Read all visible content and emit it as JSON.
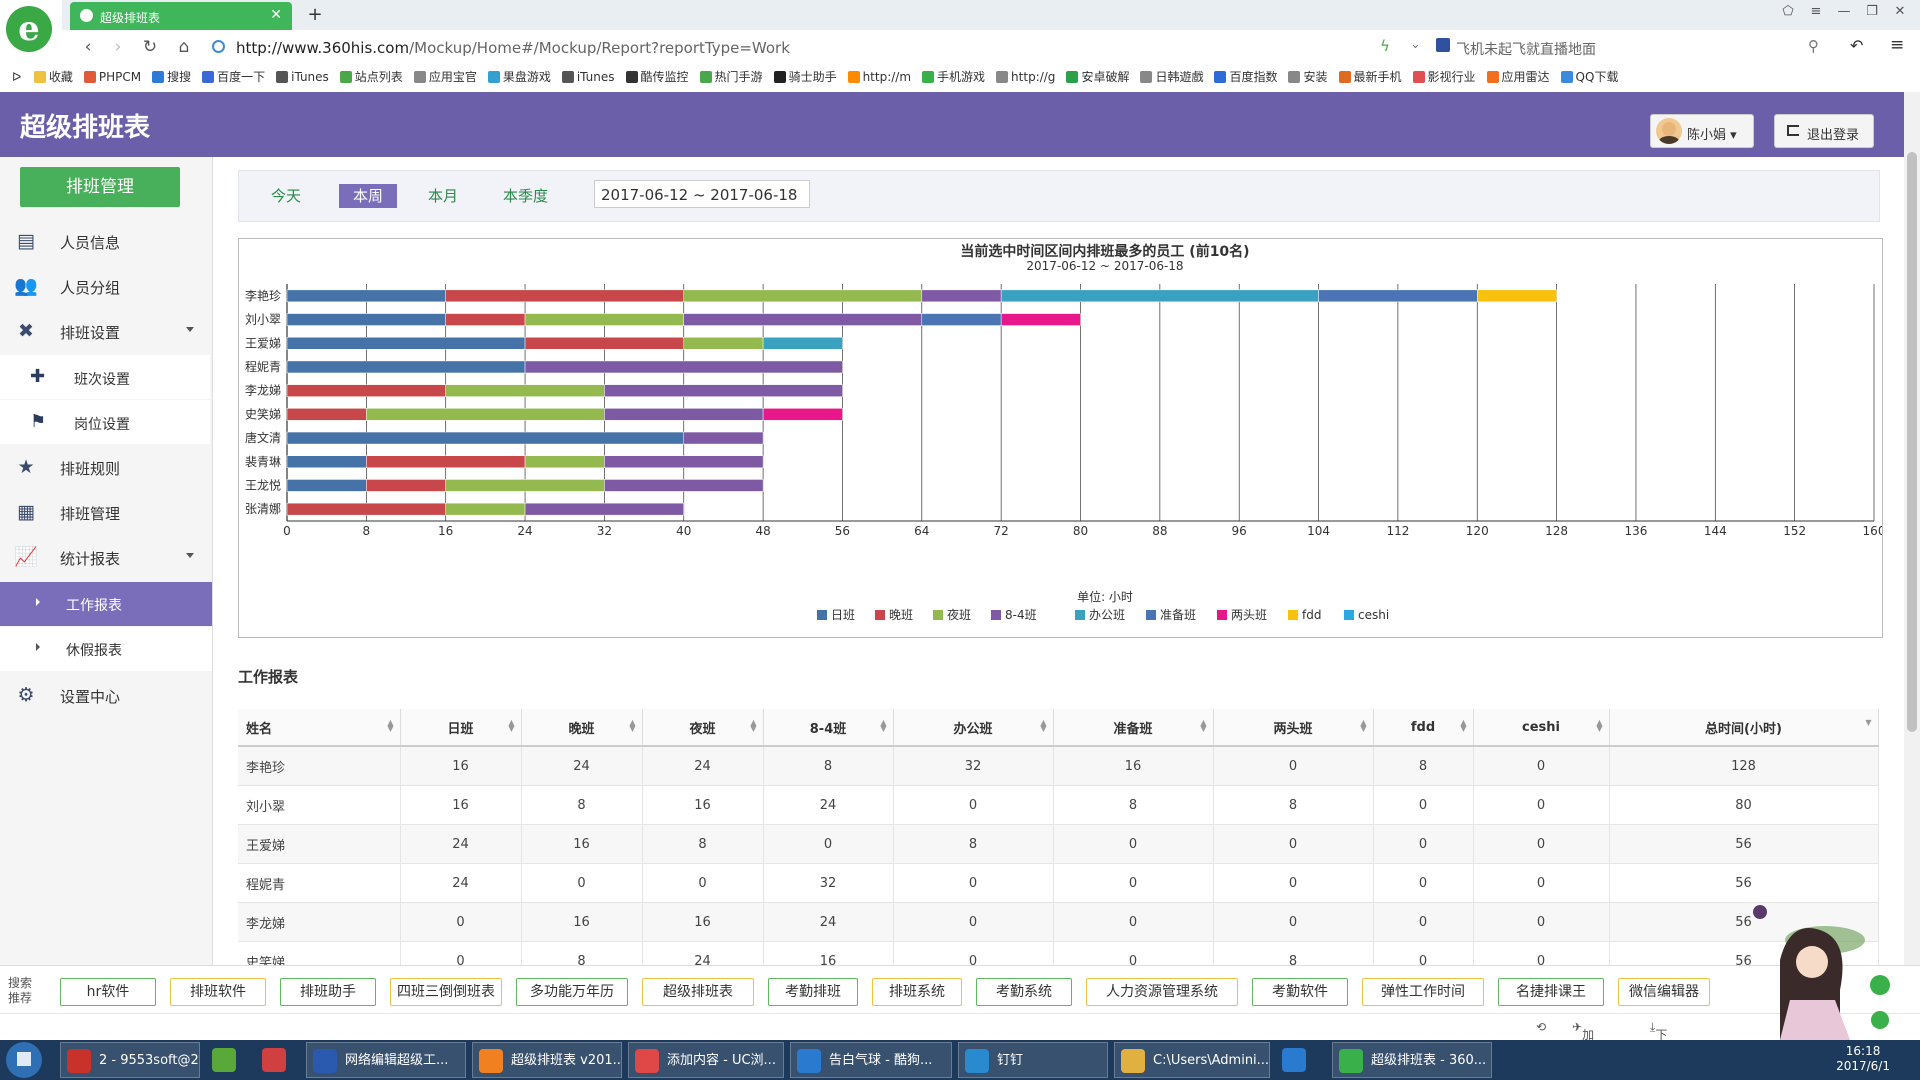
{
  "browser": {
    "tab_title": "超级排班表",
    "url_host": "http://www.360his.com",
    "url_path": "/Mockup/Home#/Mockup/Report?reportType=Work",
    "news": "飞机未起飞就直播地面",
    "bookmarks": [
      "收藏",
      "PHPCM",
      "搜搜",
      "百度一下",
      "iTunes",
      "站点列表",
      "应用宝官",
      "果盘游戏",
      "iTunes",
      "酷传监控",
      "热门手游",
      "骑士助手",
      "http://m",
      "手机游戏",
      "http://g",
      "安卓破解",
      "日韩遊戲",
      "百度指数",
      "安装",
      "最新手机",
      "影视行业",
      "应用雷达",
      "QQ下载"
    ],
    "bookmark_colors": [
      "#f0c040",
      "#e05a3a",
      "#2e7bd6",
      "#3a6ad6",
      "#555",
      "#4aa84a",
      "#888",
      "#35a0d0",
      "#555",
      "#333",
      "#4aa84a",
      "#222",
      "#ff8a00",
      "#3ab04a",
      "#888",
      "#2aa04a",
      "#888",
      "#2e6bd6",
      "#888",
      "#e06a20",
      "#e05050",
      "#f07020",
      "#3a8ae0"
    ]
  },
  "app": {
    "title": "超级排班表",
    "user_name": "陈小娟",
    "logout_label": "退出登录"
  },
  "sidebar": {
    "main_button": "排班管理",
    "items": [
      {
        "label": "人员信息",
        "icon": "id-card-icon",
        "glyph": "▤"
      },
      {
        "label": "人员分组",
        "icon": "group-icon",
        "glyph": "👥"
      },
      {
        "label": "排班设置",
        "icon": "wrench-icon",
        "glyph": "✖"
      },
      {
        "label": "排班规则",
        "icon": "star-icon",
        "glyph": "★"
      },
      {
        "label": "排班管理",
        "icon": "calendar-icon",
        "glyph": "▦"
      },
      {
        "label": "统计报表",
        "icon": "chart-icon",
        "glyph": "📈"
      },
      {
        "label": "设置中心",
        "icon": "gear-icon",
        "glyph": "⚙"
      }
    ],
    "sub_items": [
      {
        "label": "班次设置",
        "icon": "puzzle-icon",
        "glyph": "✚"
      },
      {
        "label": "岗位设置",
        "icon": "flag-icon",
        "glyph": "⚑"
      }
    ],
    "report_items": [
      {
        "label": "工作报表"
      },
      {
        "label": "休假报表"
      }
    ]
  },
  "filter": {
    "periods": [
      "今天",
      "本周",
      "本月",
      "本季度"
    ],
    "active_period": "本周",
    "date_range": "2017-06-12 ~ 2017-06-18"
  },
  "chart_data": {
    "type": "bar",
    "orientation": "horizontal",
    "stacked": true,
    "title": "当前选中时间区间内排班最多的员工 (前10名)",
    "subtitle": "2017-06-12 ~ 2017-06-18",
    "xlabel": "单位: 小时",
    "xlim": [
      0,
      160
    ],
    "xticks": [
      0,
      8,
      16,
      24,
      32,
      40,
      48,
      56,
      64,
      72,
      80,
      88,
      96,
      104,
      112,
      120,
      128,
      136,
      144,
      152,
      160
    ],
    "grid": true,
    "legend_position": "bottom",
    "categories": [
      "李艳珍",
      "刘小翠",
      "王爱娣",
      "程妮青",
      "李龙娣",
      "史笑娣",
      "唐文清",
      "裴青琳",
      "王龙悦",
      "张清娜"
    ],
    "series": [
      {
        "name": "日班",
        "color": "#4572a7",
        "values": [
          16,
          16,
          24,
          24,
          0,
          0,
          40,
          8,
          8,
          0
        ]
      },
      {
        "name": "晚班",
        "color": "#c8474a",
        "values": [
          24,
          8,
          16,
          0,
          16,
          8,
          0,
          16,
          8,
          16
        ]
      },
      {
        "name": "夜班",
        "color": "#93b94f",
        "values": [
          24,
          16,
          8,
          0,
          16,
          24,
          0,
          8,
          16,
          8
        ]
      },
      {
        "name": "8-4班",
        "color": "#7d5aa3",
        "values": [
          8,
          24,
          0,
          32,
          24,
          16,
          8,
          16,
          16,
          16
        ]
      },
      {
        "name": "办公班",
        "color": "#3ba1c1",
        "values": [
          32,
          0,
          8,
          0,
          0,
          0,
          0,
          0,
          0,
          0
        ]
      },
      {
        "name": "准备班",
        "color": "#4a74b4",
        "values": [
          16,
          8,
          0,
          0,
          0,
          0,
          0,
          0,
          0,
          0
        ]
      },
      {
        "name": "两头班",
        "color": "#e8178a",
        "values": [
          0,
          8,
          0,
          0,
          0,
          8,
          0,
          0,
          0,
          0
        ]
      },
      {
        "name": "fdd",
        "color": "#f7c10d",
        "values": [
          8,
          0,
          0,
          0,
          0,
          0,
          0,
          0,
          0,
          0
        ]
      },
      {
        "name": "ceshi",
        "color": "#29a9e0",
        "values": [
          0,
          0,
          0,
          0,
          0,
          0,
          0,
          0,
          0,
          0
        ]
      }
    ]
  },
  "table": {
    "title": "工作报表",
    "headers": [
      "姓名",
      "日班",
      "晚班",
      "夜班",
      "8-4班",
      "办公班",
      "准备班",
      "两头班",
      "fdd",
      "ceshi",
      "总时间(小时)"
    ],
    "rows": [
      [
        "李艳珍",
        "16",
        "24",
        "24",
        "8",
        "32",
        "16",
        "0",
        "8",
        "0",
        "128"
      ],
      [
        "刘小翠",
        "16",
        "8",
        "16",
        "24",
        "0",
        "8",
        "8",
        "0",
        "0",
        "80"
      ],
      [
        "王爱娣",
        "24",
        "16",
        "8",
        "0",
        "8",
        "0",
        "0",
        "0",
        "0",
        "56"
      ],
      [
        "程妮青",
        "24",
        "0",
        "0",
        "32",
        "0",
        "0",
        "0",
        "0",
        "0",
        "56"
      ],
      [
        "李龙娣",
        "0",
        "16",
        "16",
        "24",
        "0",
        "0",
        "0",
        "0",
        "0",
        "56"
      ],
      [
        "史笑娣",
        "0",
        "8",
        "24",
        "16",
        "0",
        "0",
        "8",
        "0",
        "0",
        "56"
      ]
    ]
  },
  "recommend": {
    "label": "搜索推荐",
    "items": [
      "hr软件",
      "排班软件",
      "排班助手",
      "四班三倒倒班表",
      "多功能万年历",
      "超级排班表",
      "考勤排班",
      "排班系统",
      "考勤系统",
      "人力资源管理系统",
      "考勤软件",
      "弹性工作时间",
      "名捷排课王",
      "微信编辑器"
    ]
  },
  "status": {
    "accelerator": "加速器",
    "download": "下载"
  },
  "taskbar": {
    "tasks": [
      "2 - 9553soft@2...",
      "",
      "",
      "网络编辑超级工...",
      "超级排班表 v201...",
      "添加内容 - UC浏...",
      "告白气球 - 酷狗...",
      "钉钉",
      "C:\\Users\\Admini...",
      "",
      "超级排班表 - 360..."
    ],
    "task_colors": [
      "#c8322a",
      "#5aa83a",
      "#d04040",
      "#2a5ab0",
      "#f08020",
      "#e04848",
      "#2a7ad0",
      "#2a8ad0",
      "#e0b040",
      "#2a7ad0",
      "#3ab04a"
    ],
    "clock_time": "16:18",
    "clock_date": "2017/6/1"
  }
}
